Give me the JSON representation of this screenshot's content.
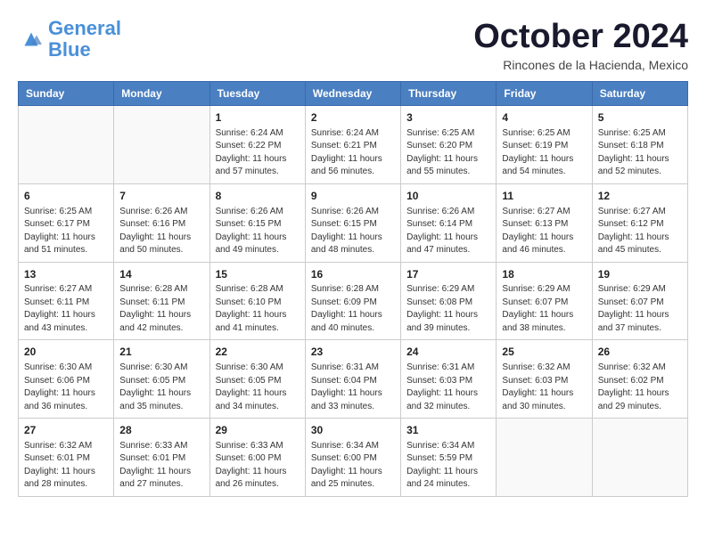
{
  "logo": {
    "line1": "General",
    "line2": "Blue"
  },
  "title": "October 2024",
  "subtitle": "Rincones de la Hacienda, Mexico",
  "days_of_week": [
    "Sunday",
    "Monday",
    "Tuesday",
    "Wednesday",
    "Thursday",
    "Friday",
    "Saturday"
  ],
  "weeks": [
    [
      {
        "day": "",
        "info": ""
      },
      {
        "day": "",
        "info": ""
      },
      {
        "day": "1",
        "info": "Sunrise: 6:24 AM\nSunset: 6:22 PM\nDaylight: 11 hours and 57 minutes."
      },
      {
        "day": "2",
        "info": "Sunrise: 6:24 AM\nSunset: 6:21 PM\nDaylight: 11 hours and 56 minutes."
      },
      {
        "day": "3",
        "info": "Sunrise: 6:25 AM\nSunset: 6:20 PM\nDaylight: 11 hours and 55 minutes."
      },
      {
        "day": "4",
        "info": "Sunrise: 6:25 AM\nSunset: 6:19 PM\nDaylight: 11 hours and 54 minutes."
      },
      {
        "day": "5",
        "info": "Sunrise: 6:25 AM\nSunset: 6:18 PM\nDaylight: 11 hours and 52 minutes."
      }
    ],
    [
      {
        "day": "6",
        "info": "Sunrise: 6:25 AM\nSunset: 6:17 PM\nDaylight: 11 hours and 51 minutes."
      },
      {
        "day": "7",
        "info": "Sunrise: 6:26 AM\nSunset: 6:16 PM\nDaylight: 11 hours and 50 minutes."
      },
      {
        "day": "8",
        "info": "Sunrise: 6:26 AM\nSunset: 6:15 PM\nDaylight: 11 hours and 49 minutes."
      },
      {
        "day": "9",
        "info": "Sunrise: 6:26 AM\nSunset: 6:15 PM\nDaylight: 11 hours and 48 minutes."
      },
      {
        "day": "10",
        "info": "Sunrise: 6:26 AM\nSunset: 6:14 PM\nDaylight: 11 hours and 47 minutes."
      },
      {
        "day": "11",
        "info": "Sunrise: 6:27 AM\nSunset: 6:13 PM\nDaylight: 11 hours and 46 minutes."
      },
      {
        "day": "12",
        "info": "Sunrise: 6:27 AM\nSunset: 6:12 PM\nDaylight: 11 hours and 45 minutes."
      }
    ],
    [
      {
        "day": "13",
        "info": "Sunrise: 6:27 AM\nSunset: 6:11 PM\nDaylight: 11 hours and 43 minutes."
      },
      {
        "day": "14",
        "info": "Sunrise: 6:28 AM\nSunset: 6:11 PM\nDaylight: 11 hours and 42 minutes."
      },
      {
        "day": "15",
        "info": "Sunrise: 6:28 AM\nSunset: 6:10 PM\nDaylight: 11 hours and 41 minutes."
      },
      {
        "day": "16",
        "info": "Sunrise: 6:28 AM\nSunset: 6:09 PM\nDaylight: 11 hours and 40 minutes."
      },
      {
        "day": "17",
        "info": "Sunrise: 6:29 AM\nSunset: 6:08 PM\nDaylight: 11 hours and 39 minutes."
      },
      {
        "day": "18",
        "info": "Sunrise: 6:29 AM\nSunset: 6:07 PM\nDaylight: 11 hours and 38 minutes."
      },
      {
        "day": "19",
        "info": "Sunrise: 6:29 AM\nSunset: 6:07 PM\nDaylight: 11 hours and 37 minutes."
      }
    ],
    [
      {
        "day": "20",
        "info": "Sunrise: 6:30 AM\nSunset: 6:06 PM\nDaylight: 11 hours and 36 minutes."
      },
      {
        "day": "21",
        "info": "Sunrise: 6:30 AM\nSunset: 6:05 PM\nDaylight: 11 hours and 35 minutes."
      },
      {
        "day": "22",
        "info": "Sunrise: 6:30 AM\nSunset: 6:05 PM\nDaylight: 11 hours and 34 minutes."
      },
      {
        "day": "23",
        "info": "Sunrise: 6:31 AM\nSunset: 6:04 PM\nDaylight: 11 hours and 33 minutes."
      },
      {
        "day": "24",
        "info": "Sunrise: 6:31 AM\nSunset: 6:03 PM\nDaylight: 11 hours and 32 minutes."
      },
      {
        "day": "25",
        "info": "Sunrise: 6:32 AM\nSunset: 6:03 PM\nDaylight: 11 hours and 30 minutes."
      },
      {
        "day": "26",
        "info": "Sunrise: 6:32 AM\nSunset: 6:02 PM\nDaylight: 11 hours and 29 minutes."
      }
    ],
    [
      {
        "day": "27",
        "info": "Sunrise: 6:32 AM\nSunset: 6:01 PM\nDaylight: 11 hours and 28 minutes."
      },
      {
        "day": "28",
        "info": "Sunrise: 6:33 AM\nSunset: 6:01 PM\nDaylight: 11 hours and 27 minutes."
      },
      {
        "day": "29",
        "info": "Sunrise: 6:33 AM\nSunset: 6:00 PM\nDaylight: 11 hours and 26 minutes."
      },
      {
        "day": "30",
        "info": "Sunrise: 6:34 AM\nSunset: 6:00 PM\nDaylight: 11 hours and 25 minutes."
      },
      {
        "day": "31",
        "info": "Sunrise: 6:34 AM\nSunset: 5:59 PM\nDaylight: 11 hours and 24 minutes."
      },
      {
        "day": "",
        "info": ""
      },
      {
        "day": "",
        "info": ""
      }
    ]
  ]
}
